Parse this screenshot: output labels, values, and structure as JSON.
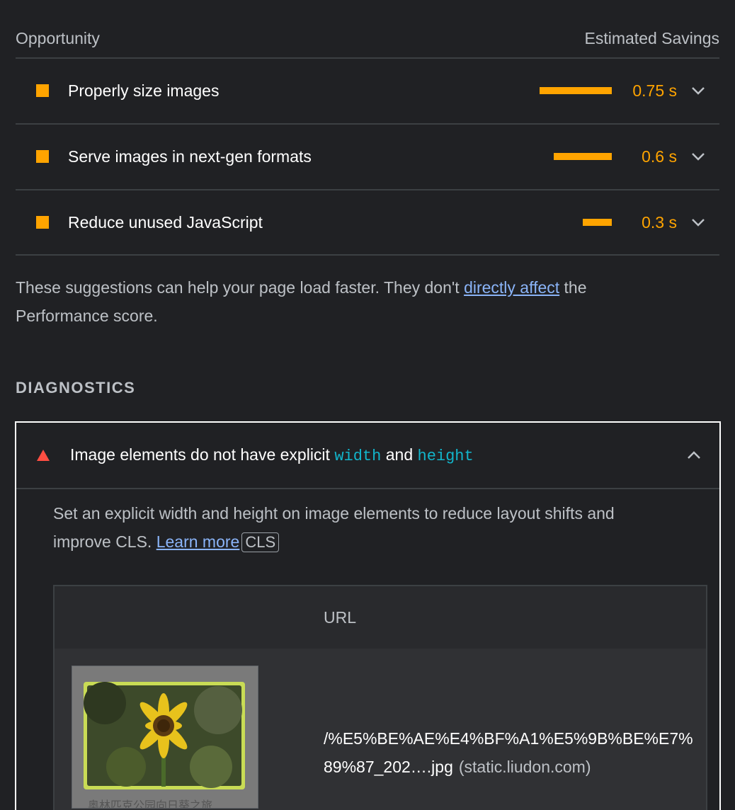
{
  "header": {
    "opportunity_label": "Opportunity",
    "savings_label": "Estimated Savings"
  },
  "opportunities": [
    {
      "title": "Properly size images",
      "savings": "0.75 s",
      "bar_fraction": 1.0
    },
    {
      "title": "Serve images in next-gen formats",
      "savings": "0.6 s",
      "bar_fraction": 0.8
    },
    {
      "title": "Reduce unused JavaScript",
      "savings": "0.3 s",
      "bar_fraction": 0.4
    }
  ],
  "note": {
    "prefix": "These suggestions can help your page load faster. They don't ",
    "link": "directly affect",
    "suffix": " the Performance score."
  },
  "diagnostics": {
    "heading": "DIAGNOSTICS",
    "item": {
      "title_prefix": "Image elements do not have explicit ",
      "code1": "width",
      "title_mid": " and ",
      "code2": "height",
      "desc_prefix": "Set an explicit width and height on image elements to reduce layout shifts and improve CLS. ",
      "learn_more": "Learn more",
      "badge": "CLS",
      "table": {
        "column_header": "URL",
        "rows": [
          {
            "thumbnail_caption": "奥林匹克公园向日葵之旅",
            "url": "/%E5%BE%AE%E4%BF%A1%E5%9B%BE%E7%89%87_202….jpg",
            "host": "(static.liudon.com)"
          }
        ]
      }
    }
  },
  "colors": {
    "background": "#202124",
    "average": "#ffa400",
    "fail": "#ff4e42",
    "link": "#8ab4f8",
    "code": "#12b5cb"
  },
  "icons": {
    "opportunity_marker": "orange-square-icon",
    "expand": "chevron-down-icon",
    "collapse": "chevron-up-icon",
    "fail_marker": "red-triangle-icon"
  }
}
